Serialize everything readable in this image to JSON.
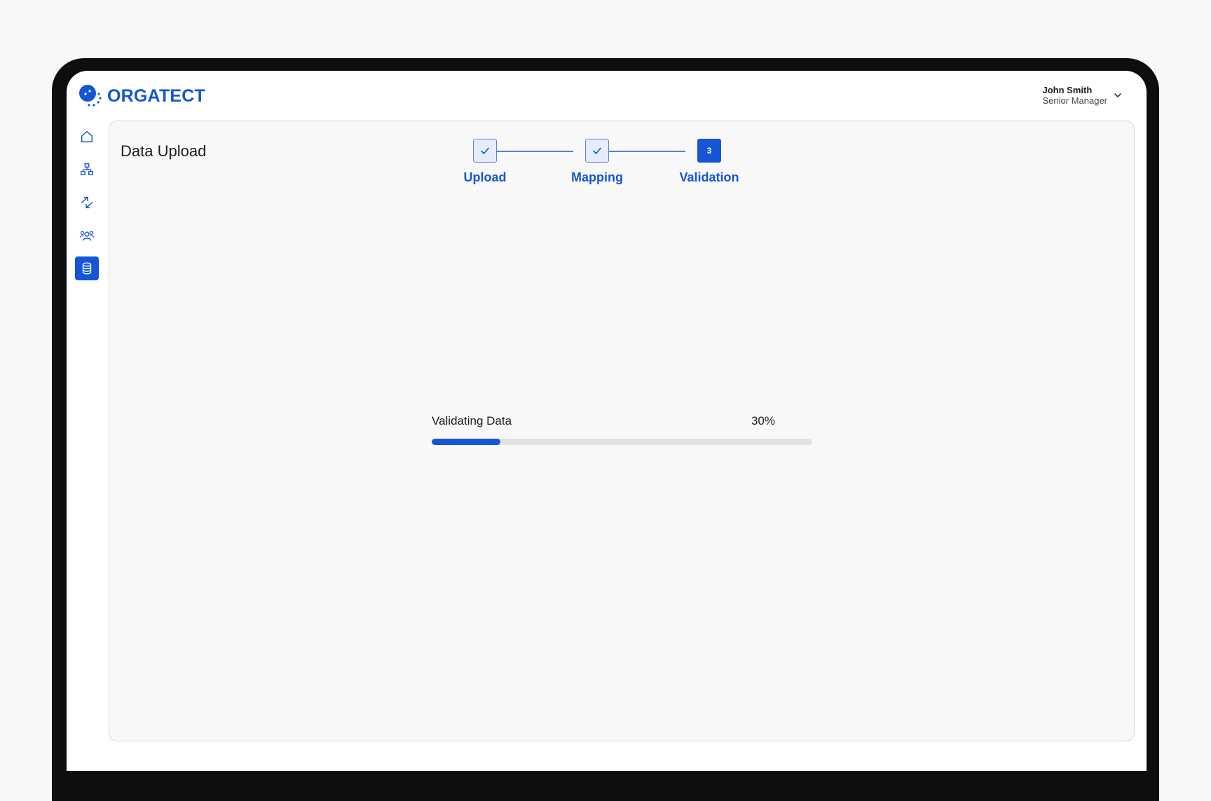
{
  "app": {
    "brand": "ORGATECT",
    "accent_color": "#1555d6"
  },
  "user": {
    "name": "John Smith",
    "role": "Senior Manager"
  },
  "sidebar": {
    "items": [
      {
        "icon": "home-icon",
        "active": false
      },
      {
        "icon": "org-chart-icon",
        "active": false
      },
      {
        "icon": "transfer-arrows-icon",
        "active": false
      },
      {
        "icon": "people-icon",
        "active": false
      },
      {
        "icon": "database-icon",
        "active": true
      }
    ]
  },
  "page": {
    "title": "Data Upload"
  },
  "stepper": {
    "steps": [
      {
        "label": "Upload",
        "status": "done"
      },
      {
        "label": "Mapping",
        "status": "done"
      },
      {
        "label": "Validation",
        "status": "current",
        "number": "3"
      }
    ]
  },
  "progress": {
    "label": "Validating Data",
    "value_text": "30%",
    "fraction": 0.18
  }
}
